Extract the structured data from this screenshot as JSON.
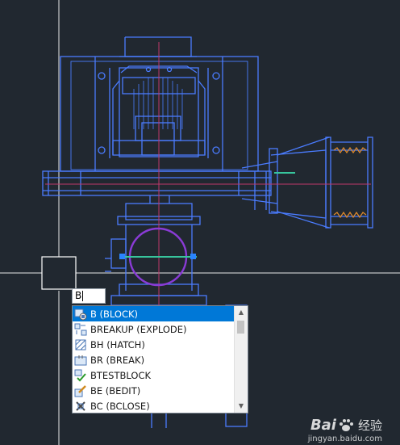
{
  "command_input": {
    "value": "B"
  },
  "autocomplete": {
    "items": [
      {
        "label": "B (BLOCK)",
        "icon": "block-icon",
        "selected": true
      },
      {
        "label": "BREAKUP (EXPLODE)",
        "icon": "explode-icon",
        "selected": false
      },
      {
        "label": "BH (HATCH)",
        "icon": "hatch-icon",
        "selected": false
      },
      {
        "label": "BR (BREAK)",
        "icon": "break-icon",
        "selected": false
      },
      {
        "label": "BTESTBLOCK",
        "icon": "testblock-check-icon",
        "selected": false
      },
      {
        "label": "BE (BEDIT)",
        "icon": "bedit-icon",
        "selected": false
      },
      {
        "label": "BC (BCLOSE)",
        "icon": "bclose-icon",
        "selected": false
      }
    ],
    "scroll_up_glyph": "▲",
    "scroll_down_glyph": "▼"
  },
  "watermark": {
    "logo": "Bai",
    "logo_suffix": "经验",
    "url": "jingyan.baidu.com"
  },
  "colors": {
    "background": "#212830",
    "drawing_lines": "#4a7cff",
    "crosshair": "#e8e8e8",
    "circle": "#8a3bd6",
    "selection": "#0078d7"
  }
}
